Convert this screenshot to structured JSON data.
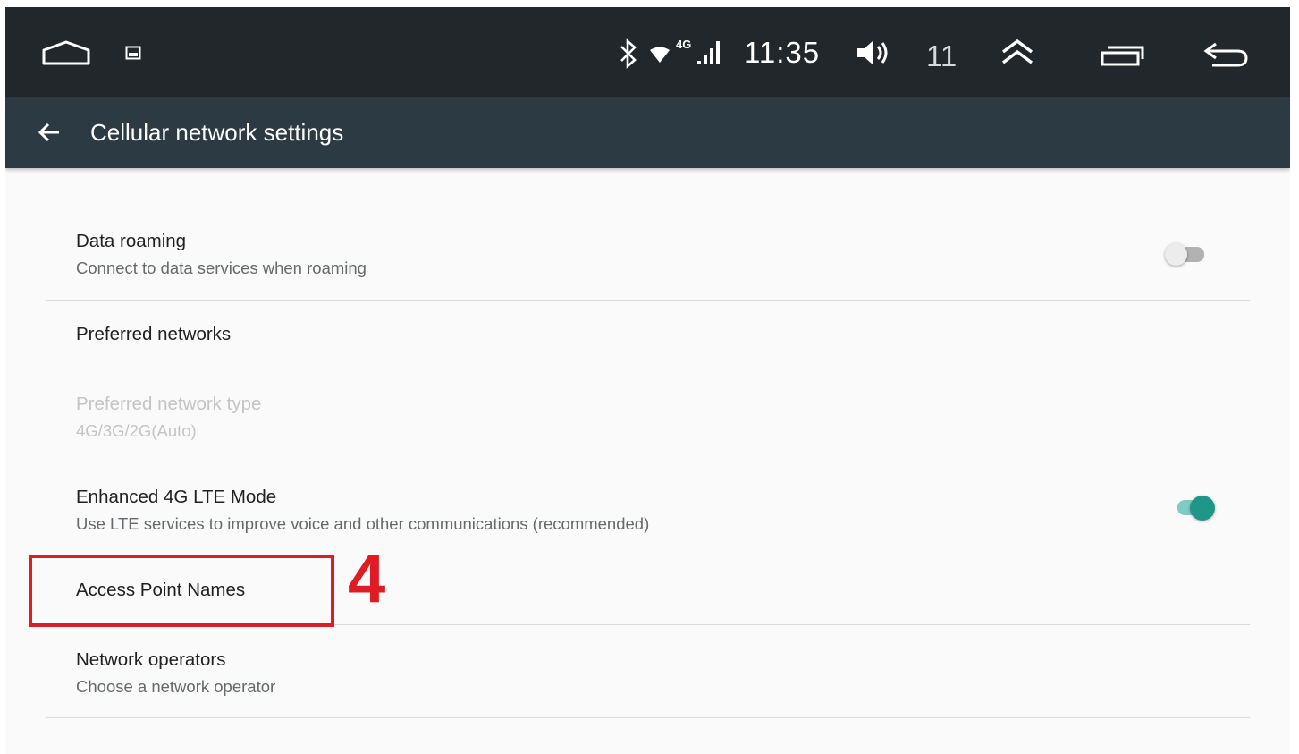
{
  "status_bar": {
    "time": "11:35",
    "volume_level": "11",
    "network_type": "4G",
    "icons": [
      "home-icon",
      "image-notification-icon",
      "bluetooth-icon",
      "wifi-icon",
      "signal-icon",
      "volume-icon",
      "expand-up-icon",
      "recents-icon",
      "back-nav-icon"
    ]
  },
  "app_bar": {
    "title": "Cellular network settings",
    "back_icon": "arrow-left-icon"
  },
  "settings": [
    {
      "title": "Data roaming",
      "subtitle": "Connect to data services when roaming",
      "toggle": false,
      "enabled": true
    },
    {
      "title": "Preferred networks",
      "subtitle": "",
      "enabled": true
    },
    {
      "title": "Preferred network type",
      "subtitle": "4G/3G/2G(Auto)",
      "enabled": false
    },
    {
      "title": "Enhanced 4G LTE Mode",
      "subtitle": "Use LTE services to improve voice and other communications (recommended)",
      "toggle": true,
      "enabled": true
    },
    {
      "title": "Access Point Names",
      "subtitle": "",
      "enabled": true
    },
    {
      "title": "Network operators",
      "subtitle": "Choose a network operator",
      "enabled": true
    }
  ],
  "annotation": {
    "step_number": "4",
    "color": "#e01b24"
  },
  "colors": {
    "status_bar": "#22272b",
    "app_bar": "#2b3a43",
    "accent": "#1e9688",
    "toggle_on_track": "#80cbc4"
  }
}
